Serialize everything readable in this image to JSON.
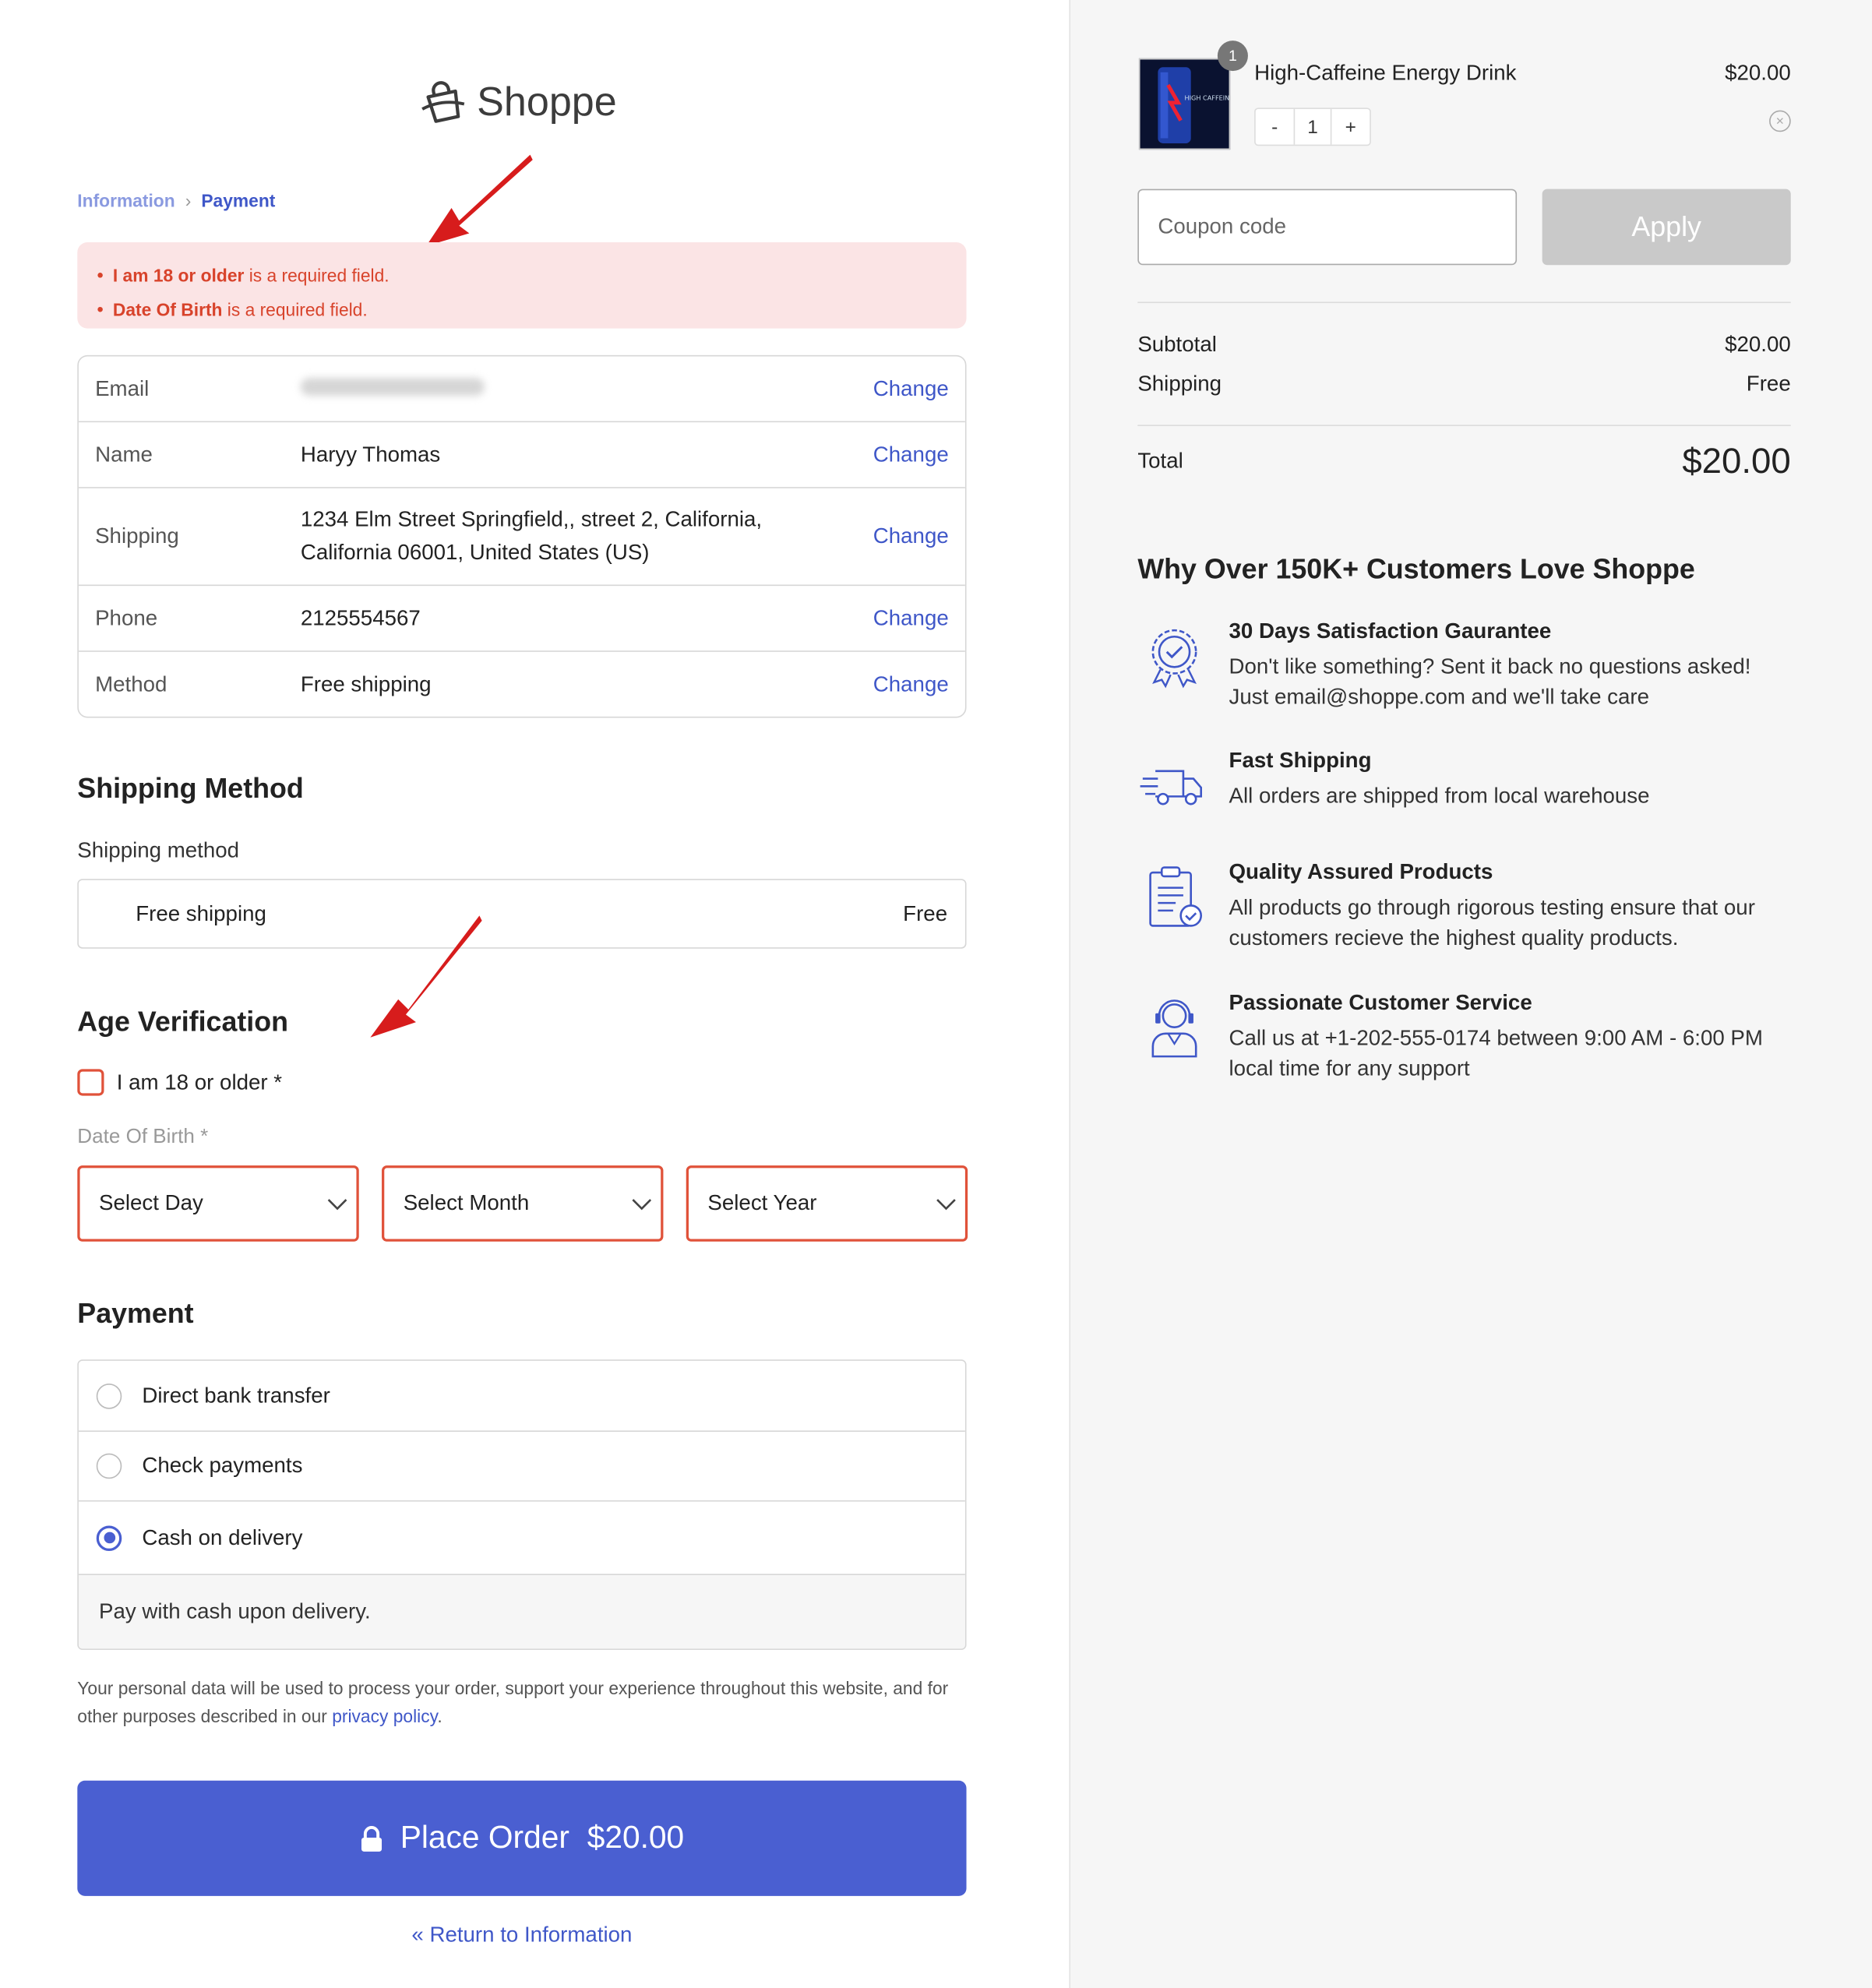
{
  "brand": {
    "name": "Shoppe",
    "accent": "#4a5fd1",
    "error": "#e0523a"
  },
  "breadcrumb": {
    "step1": "Information",
    "step2": "Payment"
  },
  "errors": {
    "e1_bold": "I am 18 or older",
    "e1_rest": " is a required field.",
    "e2_bold": "Date Of Birth",
    "e2_rest": " is a required field."
  },
  "info": {
    "change": "Change",
    "rows": [
      {
        "label": "Email",
        "value": ""
      },
      {
        "label": "Name",
        "value": "Haryy  Thomas"
      },
      {
        "label": "Shipping",
        "value": "1234 Elm Street Springfield,, street 2, California, California 06001, United States (US)"
      },
      {
        "label": "Phone",
        "value": "2125554567"
      },
      {
        "label": "Method",
        "value": "Free shipping"
      }
    ]
  },
  "shipping": {
    "heading": "Shipping Method",
    "label": "Shipping method",
    "option": "Free shipping",
    "price": "Free"
  },
  "age": {
    "heading": "Age Verification",
    "checkbox": "I am 18 or older *",
    "dob_label": "Date Of Birth *",
    "day": "Select Day",
    "month": "Select Month",
    "year": "Select Year"
  },
  "payment": {
    "heading": "Payment",
    "options": [
      "Direct bank transfer",
      "Check payments",
      "Cash on delivery"
    ],
    "selected": "Cash on delivery",
    "desc": "Pay with cash upon delivery.",
    "privacy_text": "Your personal data will be used to process your order, support your experience throughout this website, and for other purposes described in our ",
    "privacy_link": "privacy policy",
    "privacy_end": "."
  },
  "place_order": {
    "label": "Place Order",
    "amount": "$20.00"
  },
  "return_link": "« Return to Information",
  "cart": {
    "badge": "1",
    "product": "High-Caffeine Energy Drink",
    "price": "$20.00",
    "qty_minus": "-",
    "qty": "1",
    "qty_plus": "+",
    "remove": "×",
    "can_text": "HIGH CAFFEINE HIGH ENERGY",
    "coupon_placeholder": "Coupon code",
    "apply": "Apply",
    "subtotal_label": "Subtotal",
    "subtotal": "$20.00",
    "shipping_label": "Shipping",
    "shipping": "Free",
    "total_label": "Total",
    "total": "$20.00"
  },
  "why": {
    "heading": "Why Over 150K+ Customers Love Shoppe",
    "features": [
      {
        "icon": "badge-check-icon",
        "title": "30 Days Satisfaction Gaurantee",
        "desc": "Don't like something? Sent it back no questions asked! Just email@shoppe.com and we'll take care"
      },
      {
        "icon": "truck-icon",
        "title": "Fast Shipping",
        "desc": "All orders are shipped from local warehouse"
      },
      {
        "icon": "clipboard-check-icon",
        "title": "Quality Assured Products",
        "desc": "All products go through rigorous testing ensure that our customers recieve the highest quality products."
      },
      {
        "icon": "support-agent-icon",
        "title": "Passionate Customer Service",
        "desc": "Call us at +1-202-555-0174 between 9:00 AM - 6:00 PM local time for any support"
      }
    ]
  }
}
